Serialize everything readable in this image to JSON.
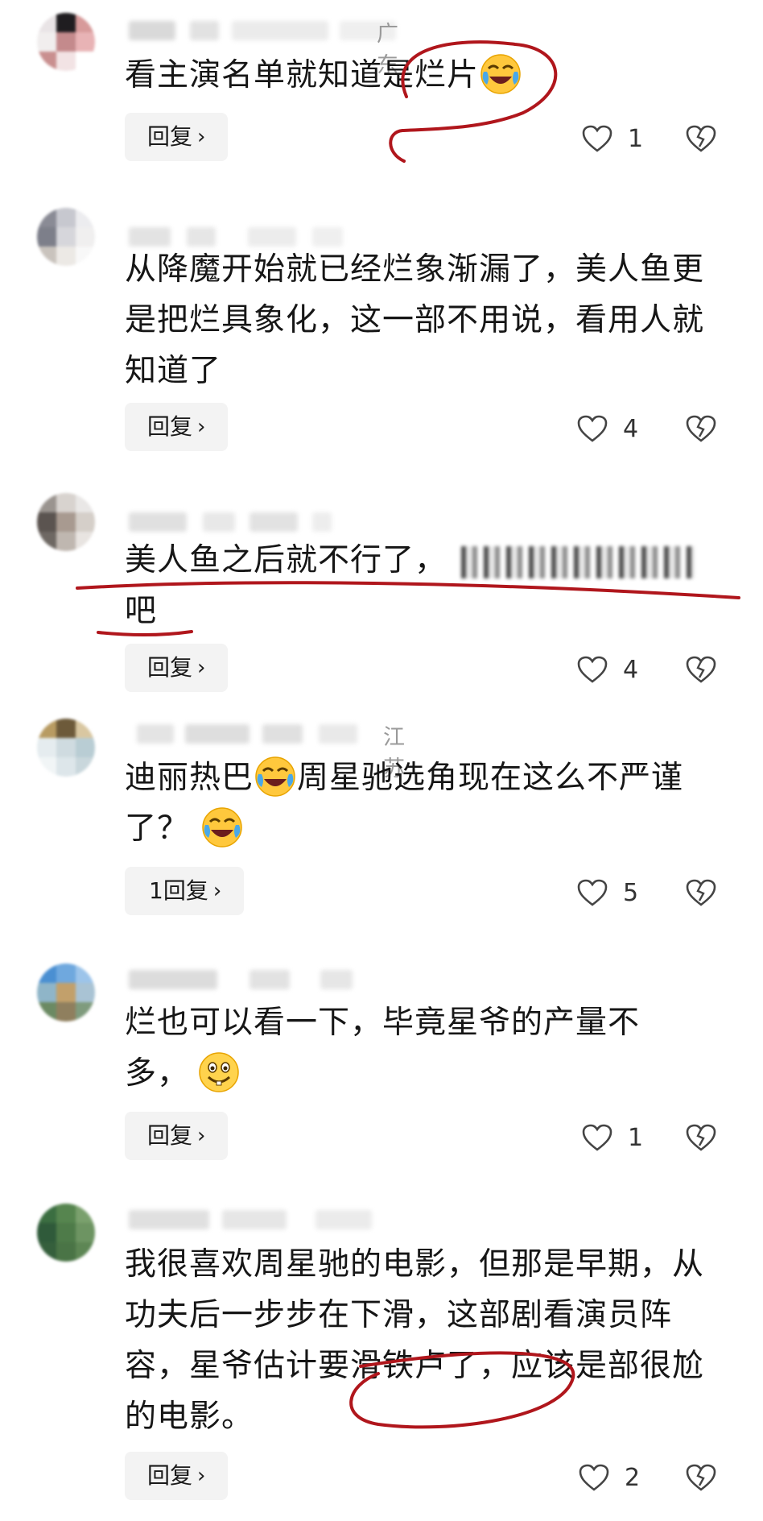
{
  "reply_label": "回复",
  "comments": [
    {
      "region": "广东",
      "text": "看主演名单就知道是烂片",
      "reply_label": "回复",
      "likes": "1",
      "avatar_colors": [
        "#e9e4e6",
        "#1f1d20",
        "#d79a9a",
        "#f1eeee",
        "#c48a8c",
        "#e8b3b5",
        "#c98f8f",
        "#f2e3e4",
        "#ffffff"
      ]
    },
    {
      "region": "",
      "text": "从降魔开始就已经烂象渐漏了，美人鱼更是把烂具象化，这一部不用说，看用人就知道了",
      "reply_label": "回复",
      "likes": "4",
      "avatar_colors": [
        "#8a8b95",
        "#c7c8cf",
        "#ececef",
        "#7d7f8a",
        "#d6d6db",
        "#f0efef",
        "#c9c3bd",
        "#ece9e5",
        "#f8f8f8"
      ]
    },
    {
      "region": "",
      "text": "美人鱼之后就不行了，",
      "text_tail": "吧",
      "reply_label": "回复",
      "likes": "4",
      "avatar_colors": [
        "#9a948f",
        "#d8d3cf",
        "#e9e7e6",
        "#5b5450",
        "#a89a90",
        "#d5cfc9",
        "#6e6863",
        "#bfb7b0",
        "#e8e4e1"
      ]
    },
    {
      "region": "江苏",
      "text": "迪丽热巴",
      "text_mid": "周星驰选角现在这么不严谨了？",
      "reply_label": "1回复",
      "likes": "5",
      "avatar_colors": [
        "#b89b62",
        "#6d5a3a",
        "#d9c7a1",
        "#e5ecef",
        "#cfdbe0",
        "#b9cdd4",
        "#f1f5f6",
        "#dde6ea",
        "#c9d7dc"
      ]
    },
    {
      "region": "",
      "text": "烂也可以看一下，毕竟星爷的产量不多，",
      "reply_label": "回复",
      "likes": "1",
      "avatar_colors": [
        "#4a8fd2",
        "#6fa8de",
        "#9cc4ea",
        "#8fb5c8",
        "#c2a06b",
        "#a9c3d4",
        "#6b8a63",
        "#8f7f5e",
        "#7f9b7d"
      ]
    },
    {
      "region": "",
      "text": "我很喜欢周星驰的电影，但那是早期，从功夫后一步步在下滑，这部剧看演员阵容，星爷估计要滑铁卢了，应该是部很尬的电影。",
      "reply_label": "回复",
      "likes": "2",
      "avatar_colors": [
        "#3b6e41",
        "#56854f",
        "#7aa06d",
        "#2f5a3a",
        "#4e7b49",
        "#6d9462",
        "#355f3c",
        "#4a7446",
        "#5d8654"
      ]
    }
  ],
  "colors": {
    "annotation_red": "#b0161c",
    "text": "#161616",
    "muted": "#9a9a9a",
    "button_bg": "#f3f3f3"
  },
  "icons": [
    "heart-outline-icon",
    "broken-heart-icon",
    "chevron-right-icon",
    "laughing-crying-emoji",
    "grinning-emoji"
  ]
}
